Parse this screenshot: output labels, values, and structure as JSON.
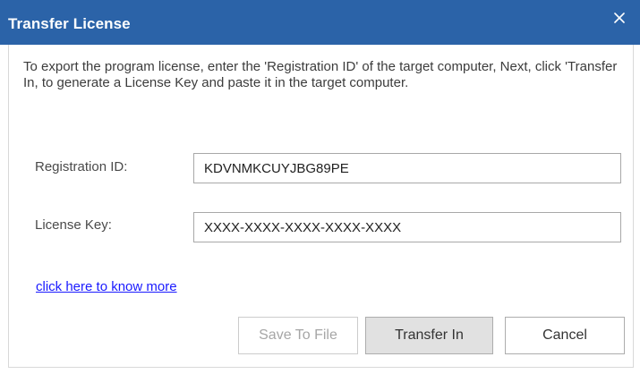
{
  "window": {
    "title": "Transfer License",
    "close_icon": "close-icon",
    "accent_color": "#2b63a8"
  },
  "instructions": "To export the program license, enter the 'Registration ID' of the target computer, Next, click 'Transfer In, to generate a License Key and paste it in the target computer.",
  "fields": {
    "registration_id": {
      "label": "Registration ID:",
      "value": "KDVNMKCUYJBG89PE"
    },
    "license_key": {
      "label": "License Key:",
      "value": "XXXX-XXXX-XXXX-XXXX-XXXX"
    }
  },
  "link": {
    "text": "click here to know more",
    "color": "#1a1aff"
  },
  "buttons": {
    "save_to_file": "Save To File",
    "transfer_in": "Transfer In",
    "cancel": "Cancel"
  }
}
